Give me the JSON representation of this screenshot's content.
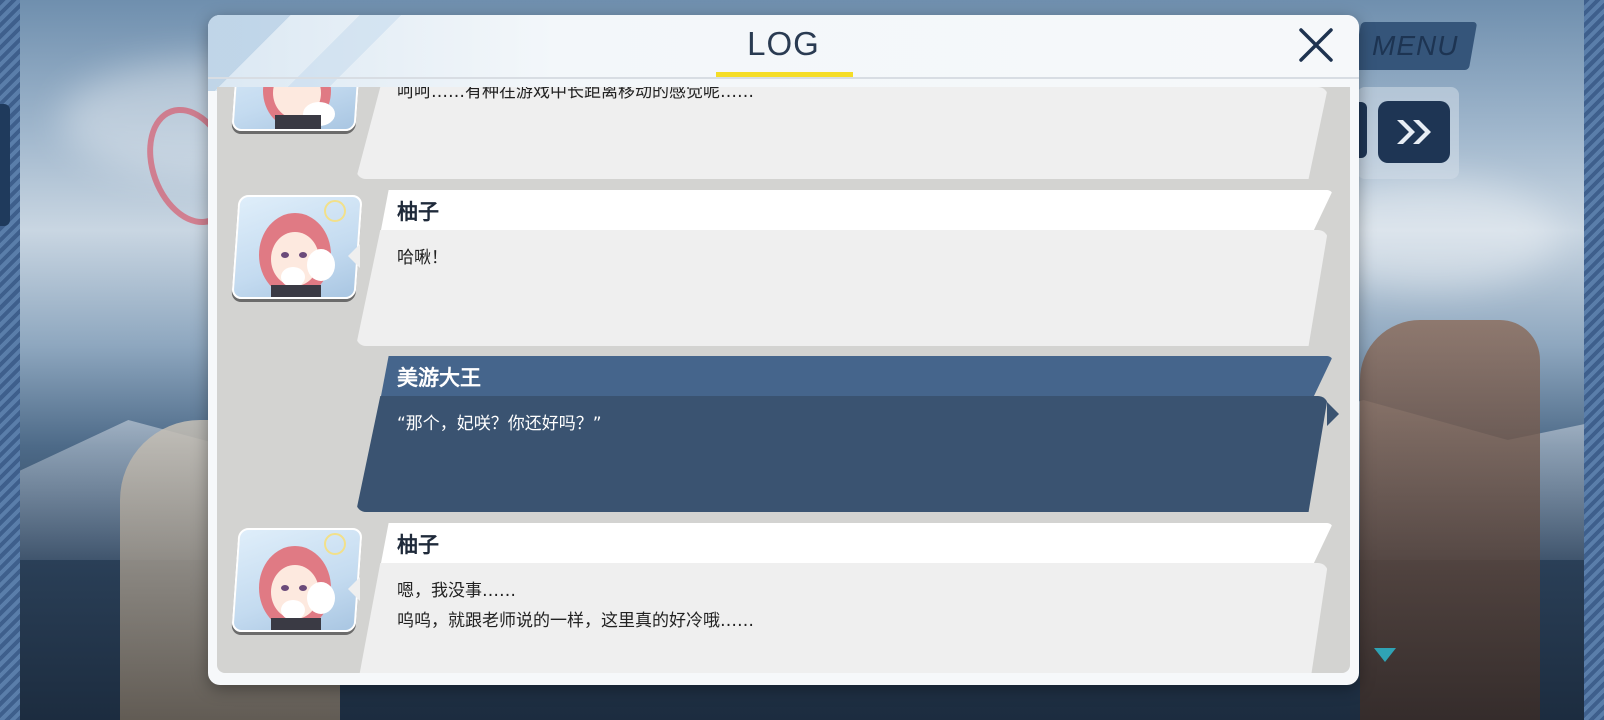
{
  "hud": {
    "menu_label": "MENU"
  },
  "log": {
    "title": "LOG",
    "entries": [
      {
        "speaker": "",
        "text": "呵呵……有种在游戏中长距离移动的感觉呢……"
      },
      {
        "speaker": "柚子",
        "text": "哈啾！"
      },
      {
        "speaker": "美游大王",
        "text": "“那个，妃咲？你还好吗？”"
      },
      {
        "speaker": "柚子",
        "text": "嗯，我没事……\n呜呜，就跟老师说的一样，这里真的好冷哦……"
      }
    ]
  },
  "icons": {
    "close": "close-icon",
    "fast_forward": "fast-forward-icon",
    "scroll_down": "triangle-down-icon",
    "avatar": "character-portrait"
  },
  "colors": {
    "accent_underline": "#f5dd27",
    "player_bubble": "#3a5371",
    "player_name_bar": "#45658c",
    "npc_bubble": "#efefef",
    "hud_button": "#1e3554"
  }
}
